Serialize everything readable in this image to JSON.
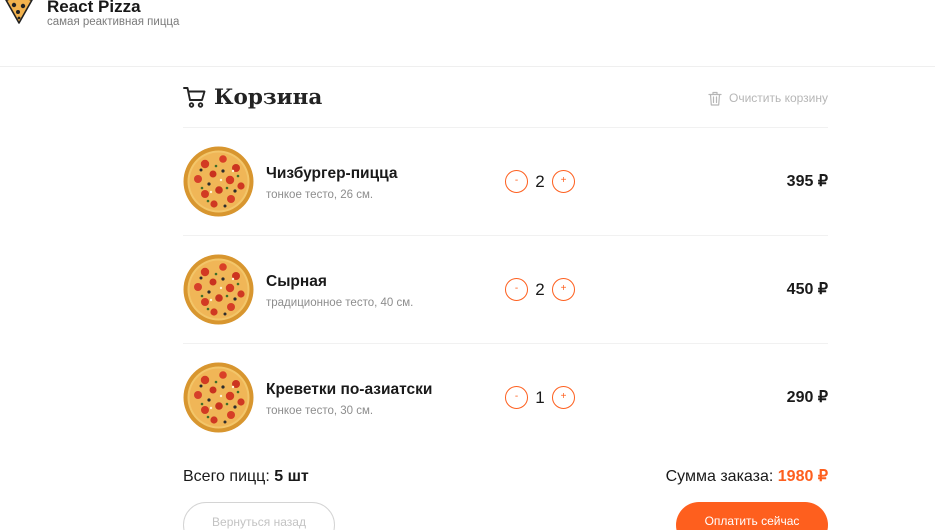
{
  "header": {
    "title": "React Pizza",
    "subtitle": "самая реактивная пицца",
    "logo_icon": "pizza-slice-icon"
  },
  "cart": {
    "title": "Корзина",
    "cart_icon": "shopping-cart-icon",
    "clear_label": "Очистить корзину",
    "clear_icon": "trash-icon",
    "items": [
      {
        "name": "Чизбургер-пицца",
        "desc": "тонкое тесто, 26 см.",
        "minus": "-",
        "plus": "+",
        "qty": "2",
        "price": "395 ₽"
      },
      {
        "name": "Сырная",
        "desc": "традиционное тесто, 40 см.",
        "minus": "-",
        "plus": "+",
        "qty": "2",
        "price": "450 ₽"
      },
      {
        "name": "Креветки по-азиатски",
        "desc": "тонкое тесто, 30 см.",
        "minus": "-",
        "plus": "+",
        "qty": "1",
        "price": "290 ₽"
      }
    ],
    "total_label": "Всего пицц:",
    "total_count": "5 шт",
    "sum_label": "Сумма заказа:",
    "sum_value": "1980 ₽",
    "back_label": "Вернуться назад",
    "pay_label": "Оплатить сейчас"
  },
  "colors": {
    "accent": "#fe5f1e",
    "muted_text": "#8d8d8d",
    "divider": "#f1f1f1"
  }
}
